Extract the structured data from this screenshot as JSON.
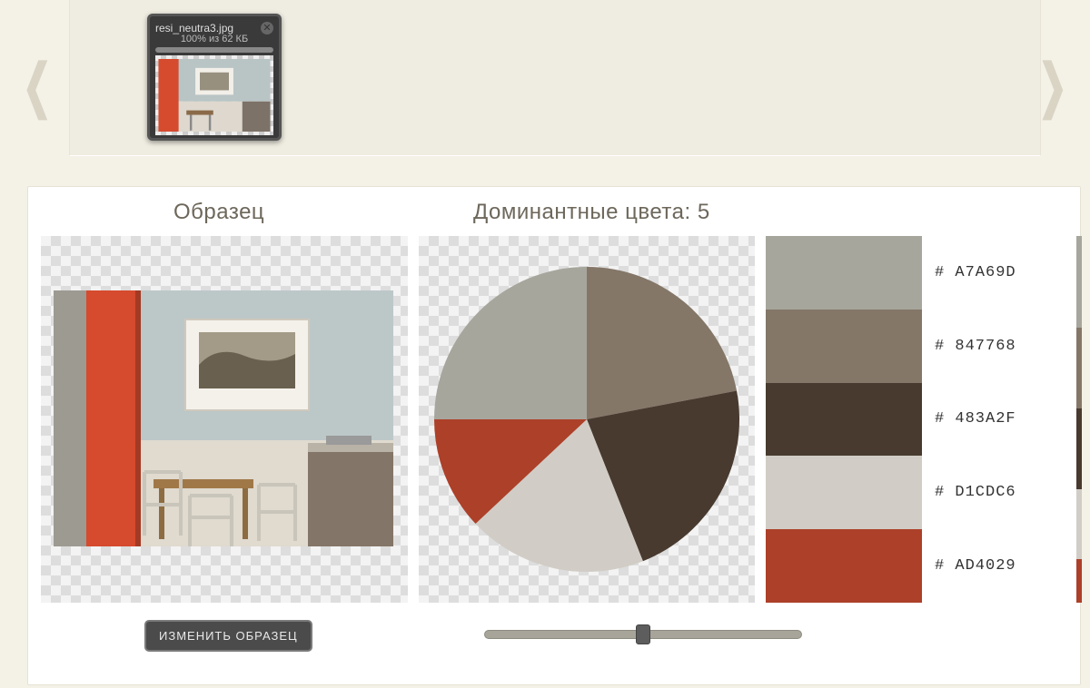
{
  "upload": {
    "filename": "resi_neutra3.jpg",
    "progress_text": "100% из 62 КБ"
  },
  "headings": {
    "sample": "Образец",
    "dominant_prefix": "Доминантные цвета: ",
    "dominant_count": "5"
  },
  "button": {
    "change_sample": "ИЗМЕНИТЬ ОБРАЗЕЦ"
  },
  "slider": {
    "position_percent": 50
  },
  "palette": [
    {
      "hex": "A7A69D",
      "pct": 25
    },
    {
      "hex": "847768",
      "pct": 22
    },
    {
      "hex": "483A2F",
      "pct": 22
    },
    {
      "hex": "D1CDC6",
      "pct": 19
    },
    {
      "hex": "AD4029",
      "pct": 12
    }
  ],
  "chart_data": {
    "type": "pie",
    "title": "Доминантные цвета: 5",
    "series": [
      {
        "name": "#A7A69D",
        "value": 25
      },
      {
        "name": "#847768",
        "value": 22
      },
      {
        "name": "#483A2F",
        "value": 22
      },
      {
        "name": "#D1CDC6",
        "value": 19
      },
      {
        "name": "#AD4029",
        "value": 12
      }
    ]
  }
}
